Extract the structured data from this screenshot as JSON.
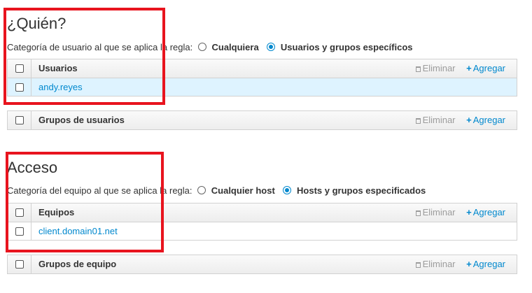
{
  "quien": {
    "title": "¿Quién?",
    "prompt": "Categoría de usuario al que se aplica la regla:",
    "options": [
      "Cualquiera",
      "Usuarios y grupos específicos"
    ],
    "selected": 1,
    "users_table": {
      "header": "Usuarios",
      "delete_label": "Eliminar",
      "add_label": "Agregar",
      "rows": [
        "andy.reyes"
      ]
    },
    "groups_table": {
      "header": "Grupos de usuarios",
      "delete_label": "Eliminar",
      "add_label": "Agregar"
    }
  },
  "acceso": {
    "title": "Acceso",
    "prompt": "Categoría del equipo al que se aplica la regla:",
    "options": [
      "Cualquier host",
      "Hosts y grupos especificados"
    ],
    "selected": 1,
    "hosts_table": {
      "header": "Equipos",
      "delete_label": "Eliminar",
      "add_label": "Agregar",
      "rows": [
        "client.domain01.net"
      ]
    },
    "hostgroups_table": {
      "header": "Grupos de equipo",
      "delete_label": "Eliminar",
      "add_label": "Agregar"
    }
  },
  "colors": {
    "accent": "#0088ce",
    "highlight_box": "#e8141e",
    "selected_row": "#def3ff"
  }
}
